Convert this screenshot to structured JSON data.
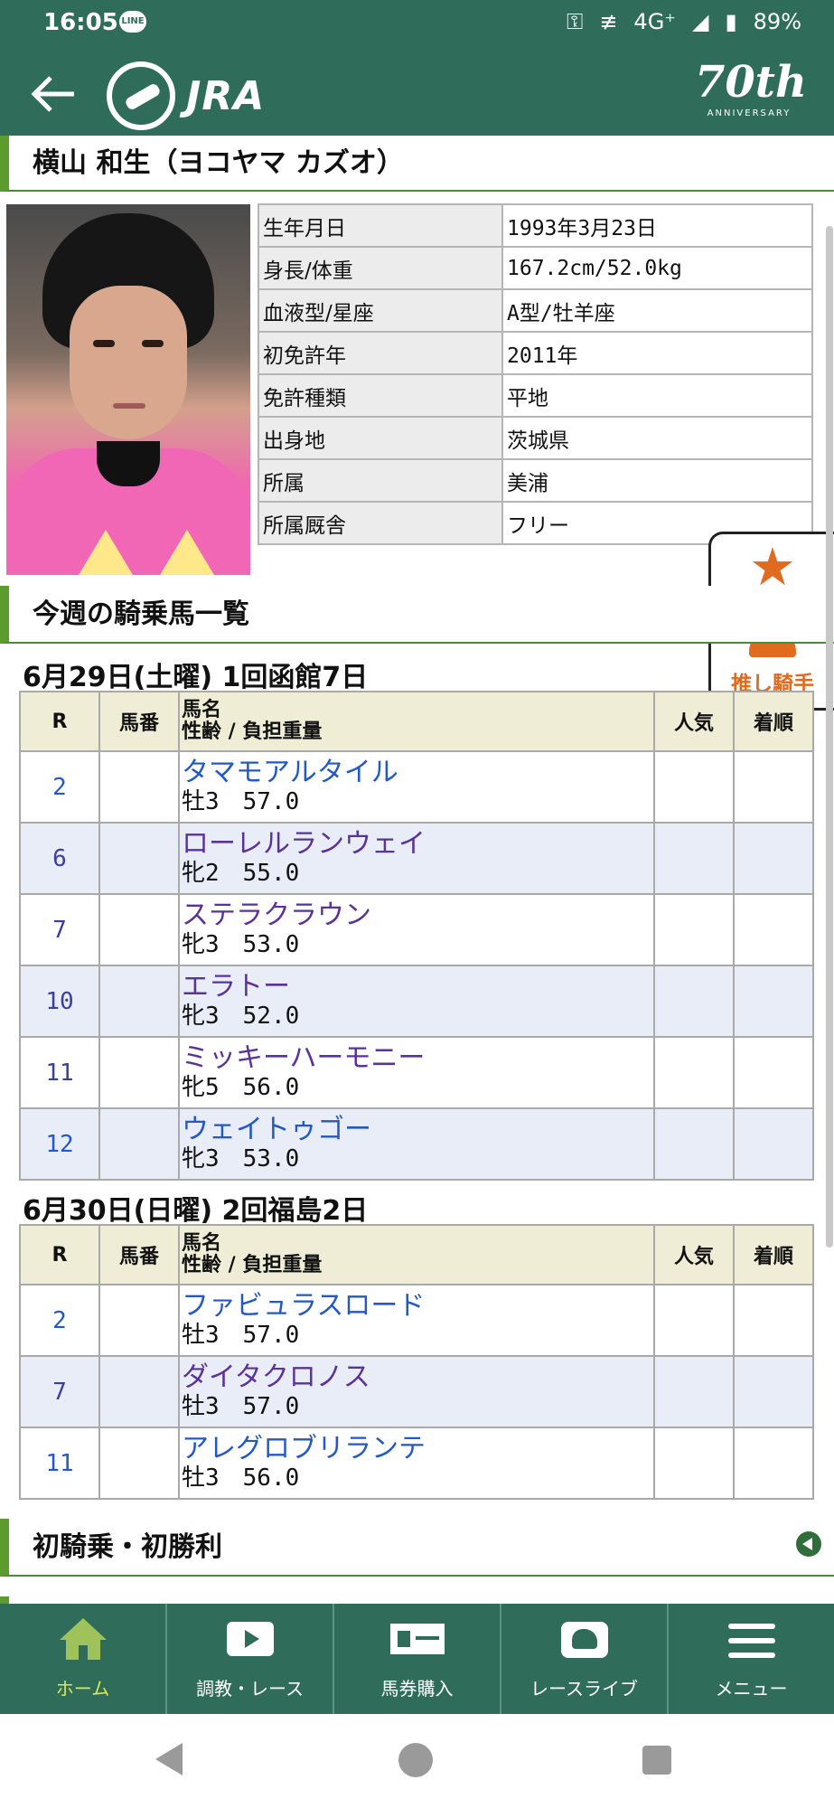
{
  "status_bar": {
    "time": "16:05",
    "line_badge": "LINE",
    "key_icon": "⚿",
    "vibrate_icon": "≢",
    "network": "4G⁺",
    "signal_icon": "◢",
    "battery_icon": "▮",
    "battery": "89%"
  },
  "app_bar": {
    "logo_text": "JRA",
    "anniversary_number": "70th",
    "anniversary_text": "ANNIVERSARY"
  },
  "jockey": {
    "name": "横山 和生（ヨコヤマ カズオ）",
    "profile": [
      {
        "label": "生年月日",
        "value": "1993年3月23日"
      },
      {
        "label": "身長/体重",
        "value": "167.2cm/52.0kg"
      },
      {
        "label": "血液型/星座",
        "value": "A型/牡羊座"
      },
      {
        "label": "初免許年",
        "value": "2011年"
      },
      {
        "label": "免許種類",
        "value": "平地"
      },
      {
        "label": "出身地",
        "value": "茨城県"
      },
      {
        "label": "所属",
        "value": "美浦"
      },
      {
        "label": "所属厩舎",
        "value": "フリー"
      }
    ]
  },
  "favorite": {
    "label": "推し騎手"
  },
  "week_section": {
    "title": "今週の騎乗馬一覧"
  },
  "table_headers": {
    "r": "R",
    "umaban": "馬番",
    "name_line1": "馬名",
    "name_line2": "性齢 / 負担重量",
    "ninki": "人気",
    "chakujun": "着順"
  },
  "days": [
    {
      "title": "6月29日(土曜) 1回函館7日",
      "races": [
        {
          "r": "2",
          "horse": "タマモアルタイル",
          "meta": "牡3　57.0"
        },
        {
          "r": "6",
          "horse": "ローレルランウェイ",
          "meta": "牝2　55.0"
        },
        {
          "r": "7",
          "horse": "ステラクラウン",
          "meta": "牝3　53.0"
        },
        {
          "r": "10",
          "horse": "エラトー",
          "meta": "牝3　52.0"
        },
        {
          "r": "11",
          "horse": "ミッキーハーモニー",
          "meta": "牝5　56.0"
        },
        {
          "r": "12",
          "horse": "ウェイトゥゴー",
          "meta": "牝3　53.0"
        }
      ]
    },
    {
      "title": "6月30日(日曜) 2回福島2日",
      "races": [
        {
          "r": "2",
          "horse": "ファビュラスロード",
          "meta": "牡3　57.0"
        },
        {
          "r": "7",
          "horse": "ダイタクロノス",
          "meta": "牡3　57.0"
        },
        {
          "r": "11",
          "horse": "アレグロブリランテ",
          "meta": "牡3　56.0"
        }
      ]
    }
  ],
  "first_section": {
    "title": "初騎乗・初勝利"
  },
  "bottom_nav": [
    {
      "label": "ホーム",
      "icon": "home-icon"
    },
    {
      "label": "調教・レース",
      "icon": "video-icon"
    },
    {
      "label": "馬券購入",
      "icon": "ticket-icon"
    },
    {
      "label": "レースライブ",
      "icon": "live-icon"
    },
    {
      "label": "メニュー",
      "icon": "menu-icon"
    }
  ]
}
